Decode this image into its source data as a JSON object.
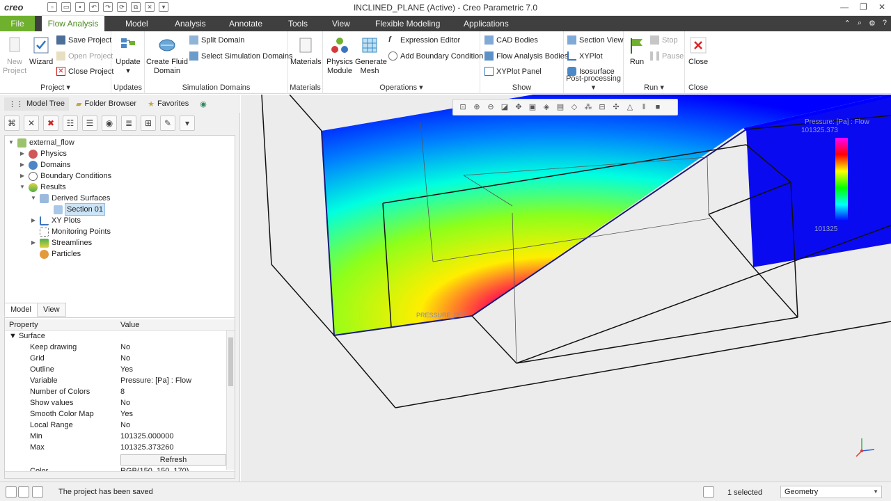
{
  "app": {
    "logo": "creo",
    "window_title": "INCLINED_PLANE (Active) - Creo Parametric 7.0"
  },
  "tabs": [
    {
      "label": "File"
    },
    {
      "label": "Flow Analysis"
    },
    {
      "label": "Model"
    },
    {
      "label": "Analysis"
    },
    {
      "label": "Annotate"
    },
    {
      "label": "Tools"
    },
    {
      "label": "View"
    },
    {
      "label": "Flexible Modeling"
    },
    {
      "label": "Applications"
    }
  ],
  "ribbon": {
    "project": {
      "label": "Project ▾",
      "new_project": "New Project",
      "wizard": "Wizard",
      "save_project": "Save Project",
      "open_project": "Open Project",
      "close_project": "Close Project"
    },
    "updates": {
      "label": "Updates",
      "update": "Update"
    },
    "simulation_domains": {
      "label": "Simulation Domains",
      "create_fluid_domain": "Create Fluid Domain",
      "split_domain": "Split Domain",
      "select_simulation_domains": "Select Simulation Domains"
    },
    "materials": {
      "label": "Materials",
      "materials": "Materials"
    },
    "operations": {
      "label": "Operations ▾",
      "physics_module": "Physics Module",
      "generate_mesh": "Generate Mesh",
      "expression_editor": "Expression Editor",
      "add_boundary_condition": "Add Boundary Condition"
    },
    "show": {
      "label": "Show",
      "cad_bodies": "CAD Bodies",
      "flow_analysis_bodies": "Flow Analysis Bodies",
      "xyplot_panel": "XYPlot Panel"
    },
    "post_processing": {
      "label": "Post-processing ▾",
      "section_view": "Section View",
      "xyplot": "XYPlot",
      "isosurface": "Isosurface"
    },
    "run": {
      "label": "Run ▾",
      "run": "Run",
      "stop": "Stop",
      "pause": "Pause"
    },
    "close": {
      "label": "Close",
      "close": "Close"
    }
  },
  "nav_tabs": [
    {
      "label": "Model Tree"
    },
    {
      "label": "Folder Browser"
    },
    {
      "label": "Favorites"
    }
  ],
  "tree": [
    {
      "label": "external_flow"
    },
    {
      "label": "Physics"
    },
    {
      "label": "Domains"
    },
    {
      "label": "Boundary Conditions"
    },
    {
      "label": "Results"
    },
    {
      "label": "Derived Surfaces"
    },
    {
      "label": "Section 01"
    },
    {
      "label": "XY Plots"
    },
    {
      "label": "Monitoring Points"
    },
    {
      "label": "Streamlines"
    },
    {
      "label": "Particles"
    }
  ],
  "prop_tabs": [
    {
      "label": "Model"
    },
    {
      "label": "View"
    }
  ],
  "properties": {
    "header_property": "Property",
    "header_value": "Value",
    "section": "Surface",
    "rows": [
      {
        "key": "Keep drawing",
        "value": "No"
      },
      {
        "key": "Grid",
        "value": "No"
      },
      {
        "key": "Outline",
        "value": "Yes"
      },
      {
        "key": "Variable",
        "value": "Pressure: [Pa] : Flow"
      },
      {
        "key": "Number of Colors",
        "value": "8"
      },
      {
        "key": "Show values",
        "value": "No"
      },
      {
        "key": "Smooth Color Map",
        "value": "Yes"
      },
      {
        "key": "Local Range",
        "value": "No"
      },
      {
        "key": "Min",
        "value": "101325.000000"
      },
      {
        "key": "Max",
        "value": "101325.373260"
      }
    ],
    "refresh": "Refresh",
    "partial_key": "Color",
    "partial_value": "RGB(150, 150, 170)"
  },
  "viewport": {
    "legend_title": "Pressure: [Pa] : Flow",
    "legend_max": "101325.373",
    "legend_min": "101325",
    "section_label": "PRESSURE_DEF",
    "colors": {
      "background": "#ececec",
      "high": "#ff00ff",
      "low": "#0000ff"
    }
  },
  "status": {
    "message": "The project has been saved",
    "selected": "1 selected",
    "filter": "Geometry"
  },
  "colors": {
    "file_tab": "#6fb12e",
    "tabbar": "#3f3f3f",
    "accent": "#4a8a1c"
  }
}
